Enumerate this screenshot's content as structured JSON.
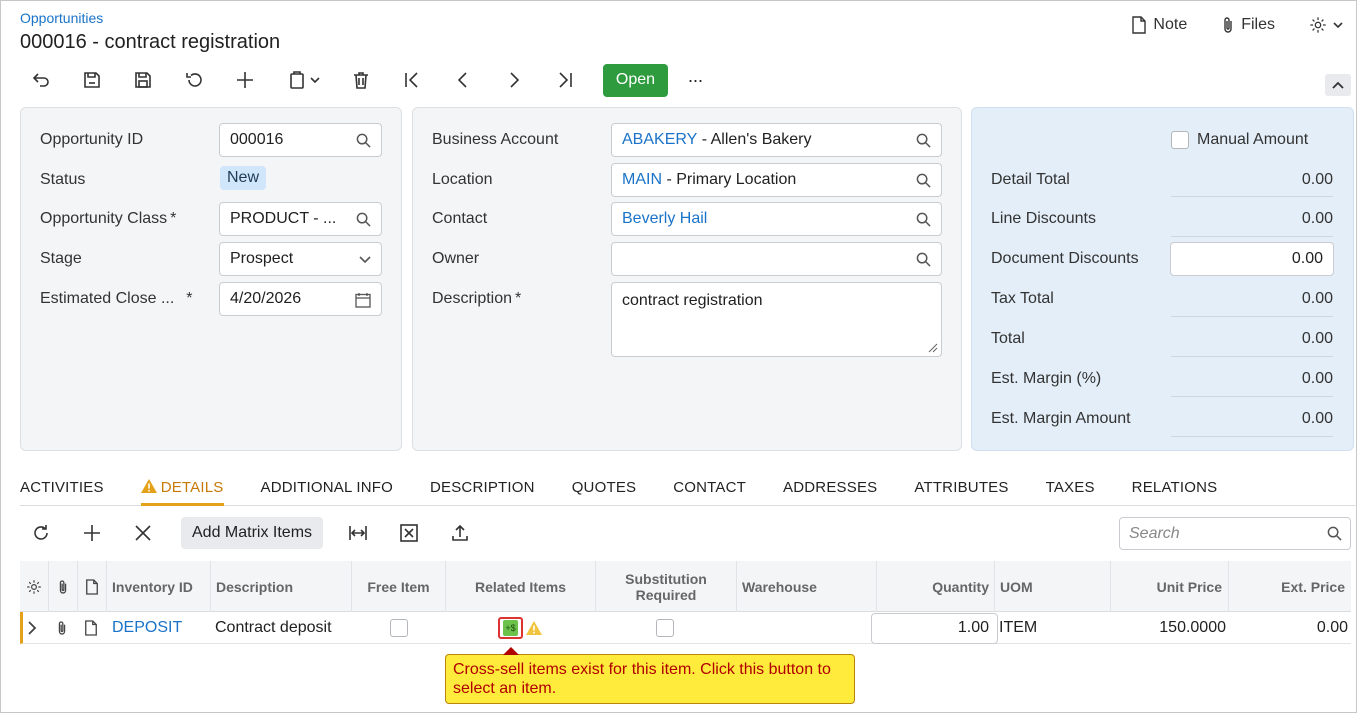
{
  "breadcrumb": "Opportunities",
  "title": "000016 - contract registration",
  "header_actions": {
    "note": "Note",
    "files": "Files"
  },
  "toolbar": {
    "open_label": "Open",
    "more": "···"
  },
  "panel1": {
    "opportunity_id_label": "Opportunity ID",
    "opportunity_id": "000016",
    "status_label": "Status",
    "status": "New",
    "class_label": "Opportunity Class",
    "class_value": "PRODUCT - ...",
    "stage_label": "Stage",
    "stage_value": "Prospect",
    "close_label": "Estimated Close ...",
    "close_value": "4/20/2026",
    "req": "*"
  },
  "panel2": {
    "business_account_label": "Business Account",
    "business_account_code": "ABAKERY",
    "business_account_name": " - Allen's Bakery",
    "location_label": "Location",
    "location_code": "MAIN",
    "location_name": " - Primary Location",
    "contact_label": "Contact",
    "contact_value": "Beverly Hail",
    "owner_label": "Owner",
    "owner_value": "",
    "description_label": "Description",
    "description_value": "contract registration",
    "req": "*"
  },
  "panel3": {
    "manual_amount_label": "Manual Amount",
    "detail_total_label": "Detail Total",
    "detail_total": "0.00",
    "line_discounts_label": "Line Discounts",
    "line_discounts": "0.00",
    "document_discounts_label": "Document Discounts",
    "document_discounts": "0.00",
    "tax_total_label": "Tax Total",
    "tax_total": "0.00",
    "total_label": "Total",
    "total": "0.00",
    "est_margin_pct_label": "Est. Margin (%)",
    "est_margin_pct": "0.00",
    "est_margin_amt_label": "Est. Margin Amount",
    "est_margin_amt": "0.00"
  },
  "tabs": [
    "ACTIVITIES",
    "DETAILS",
    "ADDITIONAL INFO",
    "DESCRIPTION",
    "QUOTES",
    "CONTACT",
    "ADDRESSES",
    "ATTRIBUTES",
    "TAXES",
    "RELATIONS"
  ],
  "grid_toolbar": {
    "add_matrix": "Add Matrix Items",
    "search_placeholder": "Search"
  },
  "grid": {
    "headers": {
      "inventory_id": "Inventory ID",
      "description": "Description",
      "free_item": "Free Item",
      "related_items": "Related Items",
      "substitution": "Substitution Required",
      "warehouse": "Warehouse",
      "quantity": "Quantity",
      "uom": "UOM",
      "unit_price": "Unit Price",
      "ext_price": "Ext. Price"
    },
    "row": {
      "inventory_id": "DEPOSIT",
      "description": "Contract deposit",
      "related_badge": "+$",
      "quantity": "1.00",
      "uom": "ITEM",
      "unit_price": "150.0000",
      "ext_price": "0.00"
    }
  },
  "tooltip": "Cross-sell items exist for this item. Click this button to select an item."
}
